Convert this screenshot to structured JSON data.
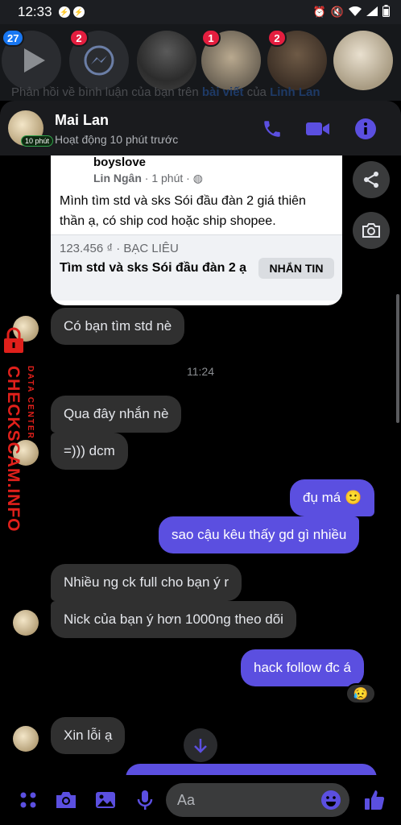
{
  "status_bar": {
    "time": "12:33"
  },
  "chat_heads": [
    {
      "name": "media-head",
      "badge": "27",
      "badge_color": "#1877f2"
    },
    {
      "name": "messenger-head",
      "badge": "2",
      "badge_color": "#e41e3f"
    },
    {
      "name": "contact-head-1",
      "badge": "",
      "badge_color": ""
    },
    {
      "name": "contact-head-2",
      "badge": "1",
      "badge_color": "#e41e3f"
    },
    {
      "name": "contact-head-3",
      "badge": "2",
      "badge_color": "#e41e3f"
    },
    {
      "name": "contact-head-4",
      "badge": "",
      "badge_color": ""
    }
  ],
  "background_notice": {
    "prefix": "Phản hồi về bình luận của bạn trên ",
    "link1": "bài viết",
    "middle": " của ",
    "link2": "Linh Lan"
  },
  "header": {
    "name": "Mai Lan",
    "status": "Hoạt động 10 phút trước",
    "active_chip": "10 phút",
    "icons": [
      "phone-icon",
      "video-icon",
      "info-icon"
    ],
    "accent": "#5b4fe0"
  },
  "shared_post": {
    "group": "boyslove",
    "author": "Lin Ngân",
    "time": " · 1 phút · ",
    "body": "Mình tìm std và sks Sói đầu đàn 2 giá thiên thần ạ, có ship cod hoặc ship shopee.",
    "price": "123.456 ₫ · BẠC LIÊU",
    "title": "Tìm std và sks Sói đầu đàn 2 ạ",
    "button": "NHẮN TIN"
  },
  "timestamp": "11:24",
  "messages": [
    {
      "id": "m1",
      "dir": "in",
      "text": "Có bạn tìm std nè"
    },
    {
      "id": "m2",
      "dir": "in",
      "text": "Qua đây nhắn nè"
    },
    {
      "id": "m3",
      "dir": "in",
      "text": "=))) dcm"
    },
    {
      "id": "m4",
      "dir": "out",
      "text": "đụ má 🙂"
    },
    {
      "id": "m5",
      "dir": "out",
      "text": "sao cậu kêu thấy gd gì nhiều"
    },
    {
      "id": "m6",
      "dir": "in",
      "text": "Nhiều ng ck full cho bạn ý r"
    },
    {
      "id": "m7",
      "dir": "in",
      "text": "Nick của bạn ý hơn 1000ng theo dõi"
    },
    {
      "id": "m8",
      "dir": "out",
      "text": "hack follow đc á",
      "reaction": "😥"
    },
    {
      "id": "m9",
      "dir": "in",
      "text": "Xin lỗi ạ"
    }
  ],
  "watermark": {
    "main": "CHECKSCAM.INFO",
    "sub": "DATA CENTER"
  },
  "composer": {
    "placeholder": "Aa"
  }
}
